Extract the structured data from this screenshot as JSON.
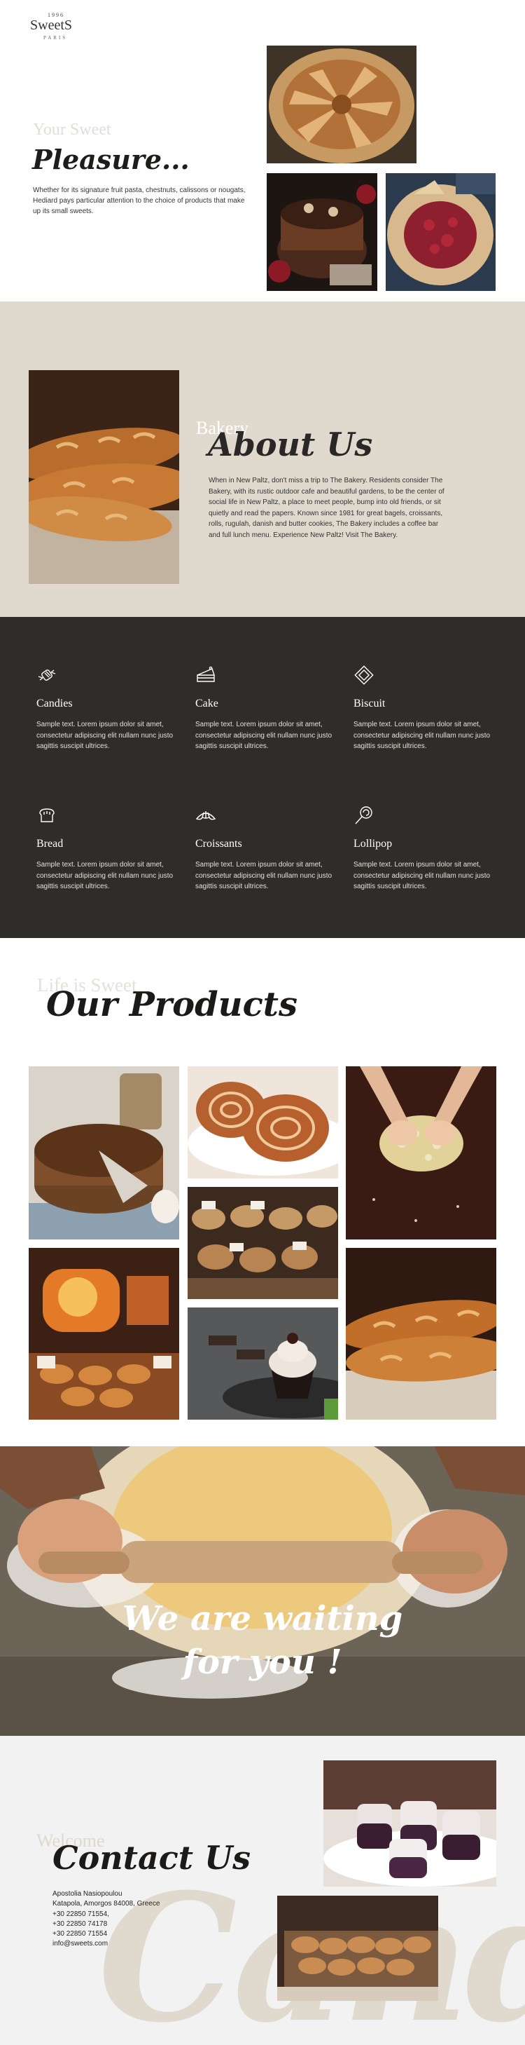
{
  "brand": {
    "year": "1996",
    "name": "SweetS",
    "city": "PARIS"
  },
  "hero": {
    "subtitle": "Your Sweet",
    "title": "Pleasure...",
    "text": "Whether for its signature fruit pasta, chestnuts, calissons or nougats, Hediard pays particular attention to the choice of products that make up its small sweets.",
    "images": [
      "galette-tart-image",
      "chocolate-cake-image",
      "berry-pie-image"
    ]
  },
  "about": {
    "subtitle": "Bakery",
    "title": "About Us",
    "text": "When in New Paltz, don't miss a trip to The Bakery. Residents consider The Bakery, with its rustic outdoor cafe and beautiful gardens, to be the center of social life in New Paltz, a place to meet people, bump into old friends, or sit quietly and read the papers. Known since 1981 for great bagels, croissants, rolls, rugulah, danish and butter cookies, The Bakery includes a coffee bar and full lunch menu. Experience New Paltz! Visit The Bakery.",
    "image": "baguettes-image"
  },
  "features": [
    {
      "icon": "candy-icon",
      "title": "Candies",
      "text": "Sample text. Lorem ipsum dolor sit amet, consectetur adipiscing elit nullam nunc justo sagittis suscipit ultrices."
    },
    {
      "icon": "cake-icon",
      "title": "Cake",
      "text": "Sample text. Lorem ipsum dolor sit amet, consectetur adipiscing elit nullam nunc justo sagittis suscipit ultrices."
    },
    {
      "icon": "biscuit-icon",
      "title": "Biscuit",
      "text": "Sample text. Lorem ipsum dolor sit amet, consectetur adipiscing elit nullam nunc justo sagittis suscipit ultrices."
    },
    {
      "icon": "bread-icon",
      "title": "Bread",
      "text": "Sample text. Lorem ipsum dolor sit amet, consectetur adipiscing elit nullam nunc justo sagittis suscipit ultrices."
    },
    {
      "icon": "croissant-icon",
      "title": "Croissants",
      "text": "Sample text. Lorem ipsum dolor sit amet, consectetur adipiscing elit nullam nunc justo sagittis suscipit ultrices."
    },
    {
      "icon": "lollipop-icon",
      "title": "Lollipop",
      "text": "Sample text. Lorem ipsum dolor sit amet, consectetur adipiscing elit nullam nunc justo sagittis suscipit ultrices."
    }
  ],
  "products": {
    "subtitle": "Life is Sweet",
    "title": "Our Products",
    "images": [
      "chocolate-tart-image",
      "cinnamon-rolls-image",
      "kneading-dough-image",
      "bakery-shelf-image",
      "bread-oven-image",
      "cupcake-image",
      "rustic-bread-image"
    ]
  },
  "waiting": {
    "line1": "We are waiting",
    "line2": "for you !"
  },
  "contact": {
    "subtitle": "Welcome",
    "title": "Contact Us",
    "background_word": "Cand",
    "name": "Apostolia Nasiopoulou",
    "address": "Katapola, Amorgos 84008, Greece",
    "phones": [
      "+30 22850 71554,",
      "+30 22850 74178",
      "+30 22850 71554"
    ],
    "email": "info@sweets.com"
  },
  "colors": {
    "about_bg": "#e0d9ce",
    "features_bg": "#2f2d29",
    "contact_bg": "#f3f2f2",
    "title_dark": "#1e1d1b"
  }
}
